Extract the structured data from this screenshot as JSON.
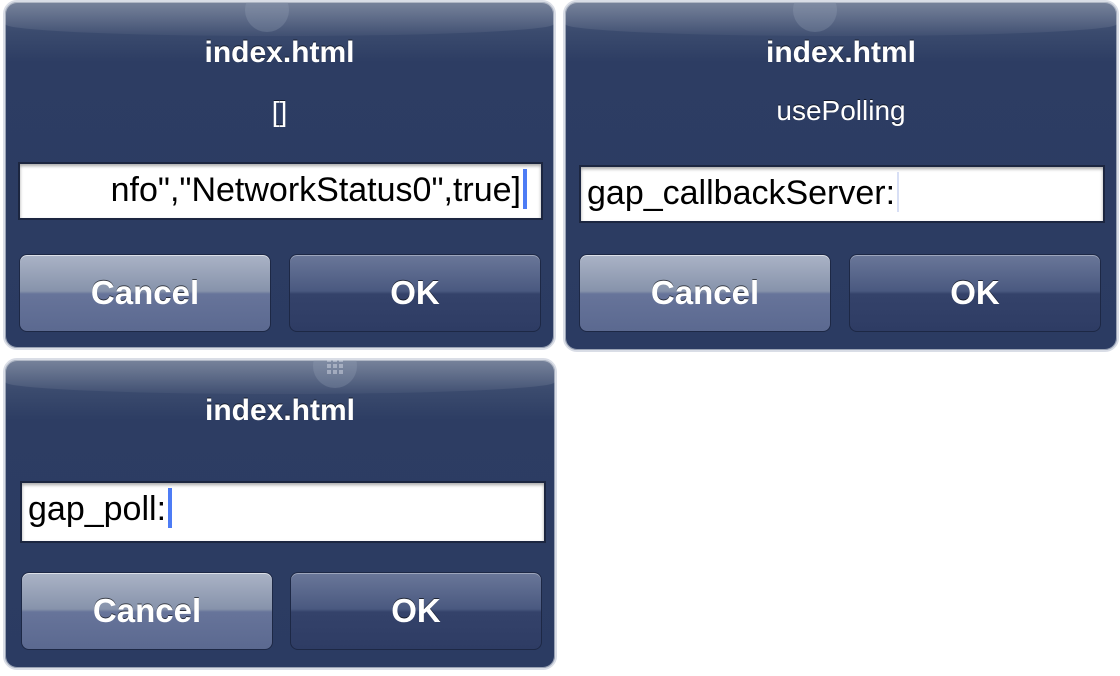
{
  "dialogs": [
    {
      "title": "index.html",
      "message": "[]",
      "input_value": "nfo\",\"NetworkStatus0\",true]",
      "cancel_label": "Cancel",
      "ok_label": "OK"
    },
    {
      "title": "index.html",
      "message": "usePolling",
      "input_value": "gap_callbackServer:",
      "cancel_label": "Cancel",
      "ok_label": "OK"
    },
    {
      "title": "index.html",
      "input_value": "gap_poll:",
      "cancel_label": "Cancel",
      "ok_label": "OK"
    }
  ],
  "colors": {
    "dialog_bg": "#2d3d63",
    "caret": "#4d7cf5",
    "text": "#ffffff"
  }
}
